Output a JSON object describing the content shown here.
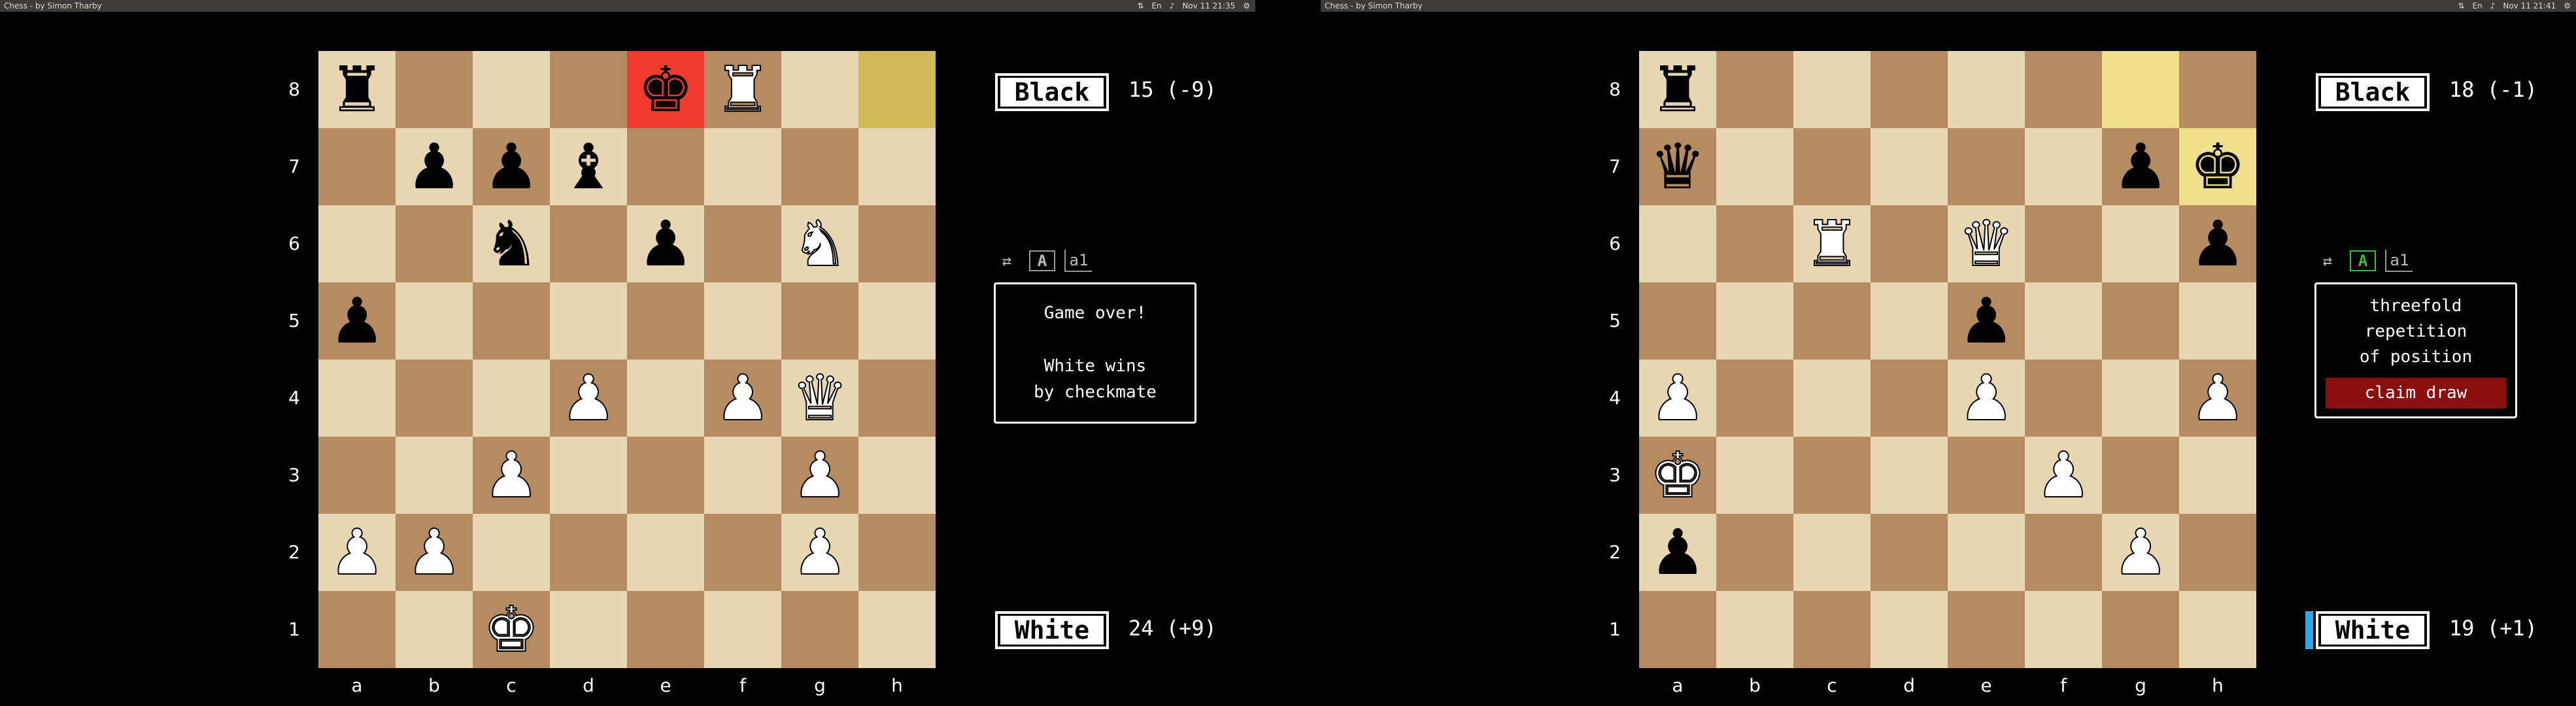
{
  "screens": [
    {
      "window_title": "Chess - by Simon Tharby",
      "clock": "Nov 11   21:35",
      "black_label": "Black",
      "black_score": "15 (-9)",
      "white_label": "White",
      "white_score": "24 (+9)",
      "ranks": [
        "8",
        "7",
        "6",
        "5",
        "4",
        "3",
        "2",
        "1"
      ],
      "files": [
        "a",
        "b",
        "c",
        "d",
        "e",
        "f",
        "g",
        "h"
      ],
      "controls": {
        "flip_icon": "flip-board-icon",
        "auto_label": "A",
        "coords_label": "a1"
      },
      "message": {
        "line1": "Game over!",
        "line2": "White wins",
        "line3": "by checkmate"
      },
      "board": [
        [
          "bR",
          "",
          "",
          "",
          "bK",
          "wR",
          "",
          ""
        ],
        [
          "",
          "bP",
          "bP",
          "bB",
          "",
          "",
          "",
          ""
        ],
        [
          "",
          "",
          "bN",
          "",
          "bP",
          "",
          "wN",
          ""
        ],
        [
          "bP",
          "",
          "",
          "",
          "",
          "",
          "",
          ""
        ],
        [
          "",
          "",
          "",
          "wP",
          "",
          "wP",
          "wQ",
          ""
        ],
        [
          "",
          "",
          "wP",
          "",
          "",
          "",
          "wP",
          ""
        ],
        [
          "wP",
          "wP",
          "",
          "",
          "",
          "",
          "wP",
          ""
        ],
        [
          "",
          "",
          "wK",
          "",
          "",
          "",
          "",
          ""
        ]
      ],
      "highlights": {
        "check": [
          "e8"
        ],
        "last_move": [
          "h8"
        ]
      }
    },
    {
      "window_title": "Chess - by Simon Tharby",
      "clock": "Nov 11   21:41",
      "black_label": "Black",
      "black_score": "18 (-1)",
      "white_label": "White",
      "white_score": "19 (+1)",
      "ranks": [
        "8",
        "7",
        "6",
        "5",
        "4",
        "3",
        "2",
        "1"
      ],
      "files": [
        "a",
        "b",
        "c",
        "d",
        "e",
        "f",
        "g",
        "h"
      ],
      "controls": {
        "flip_icon": "flip-board-icon",
        "auto_label": "A",
        "coords_label": "a1"
      },
      "message": {
        "line1": "threefold",
        "line2": "repetition",
        "line3": "of position",
        "button": "claim draw"
      },
      "board": [
        [
          "bR",
          "",
          "",
          "",
          "",
          "",
          "",
          ""
        ],
        [
          "bQ",
          "",
          "",
          "",
          "",
          "",
          "bP",
          "bK"
        ],
        [
          "",
          "",
          "wR",
          "",
          "wQ",
          "",
          "",
          "bP"
        ],
        [
          "",
          "",
          "",
          "",
          "bP",
          "",
          "",
          ""
        ],
        [
          "wP",
          "",
          "",
          "",
          "wP",
          "",
          "",
          "wP"
        ],
        [
          "wK",
          "",
          "",
          "",
          "",
          "wP",
          "",
          ""
        ],
        [
          "bP",
          "",
          "",
          "",
          "",
          "",
          "wP",
          ""
        ],
        [
          "",
          "",
          "",
          "",
          "",
          "",
          "",
          ""
        ]
      ],
      "highlights": {
        "check": [],
        "last_move": [
          "g8",
          "h7"
        ]
      }
    }
  ],
  "glyphs": {
    "K": "♚",
    "Q": "♛",
    "R": "♜",
    "B": "♝",
    "N": "♞",
    "P": "♟"
  },
  "colors": {
    "light_square": "#e8d6b2",
    "dark_square": "#b68b62",
    "check": "#ef3a2c",
    "last_move": "#d3b85a",
    "claim_button": "#8a0e0e",
    "turn_indicator": "#2da8e8"
  }
}
